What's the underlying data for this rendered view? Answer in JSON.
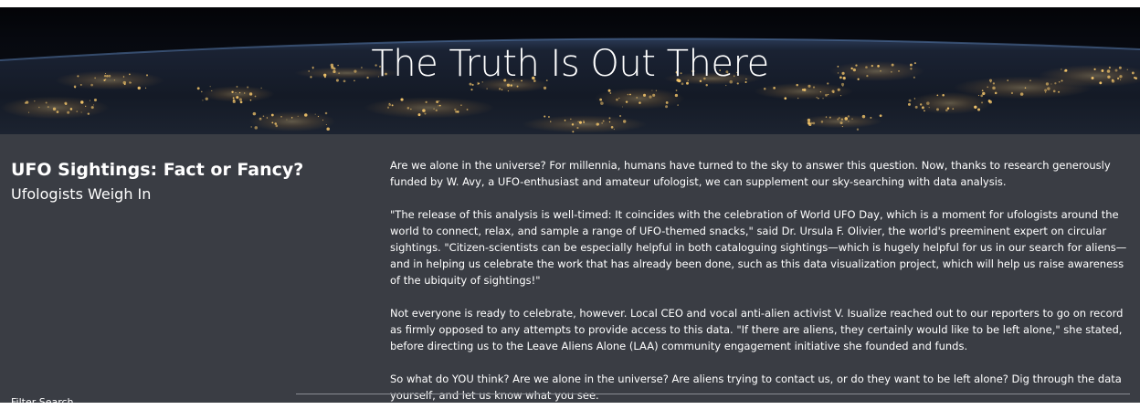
{
  "hero": {
    "title": "The Truth Is Out There"
  },
  "intro": {
    "heading_bold": "UFO Sightings: Fact or Fancy?",
    "heading_sub": "Ufologists Weigh In"
  },
  "article": {
    "paragraphs": [
      "Are we alone in the universe? For millennia, humans have turned to the sky to answer this question. Now, thanks to research generously funded by W. Avy, a UFO-enthusiast and amateur ufologist, we can supplement our sky-searching with data analysis.",
      "\"The release of this analysis is well-timed: It coincides with the celebration of World UFO Day, which is a moment for ufologists around the world to connect, relax, and sample a range of UFO-themed snacks,\" said Dr. Ursula F. Olivier, the world's preeminent expert on circular sightings. \"Citizen-scientists can be especially helpful in both cataloguing sightings—which is hugely helpful for us in our search for aliens—and in helping us celebrate the work that has already been done, such as this data visualization project, which will help us raise awareness of the ubiquity of sightings!\"",
      "Not everyone is ready to celebrate, however. Local CEO and vocal anti-alien activist V. Isualize reached out to our reporters to go on record as firmly opposed to any attempts to provide access to this data. \"If there are aliens, they certainly would like to be left alone,\" she stated, before directing us to the Leave Aliens Alone (LAA) community engagement initiative she founded and funds.",
      "So what do YOU think? Are we alone in the universe? Are aliens trying to contact us, or do they want to be left alone? Dig through the data yourself, and let us know what you see."
    ]
  },
  "filters": {
    "label": "Filter Search"
  },
  "colors": {
    "panel_background": "#3a3d44",
    "hero_background": "#06080d",
    "city_lights": "#f2c46a"
  }
}
